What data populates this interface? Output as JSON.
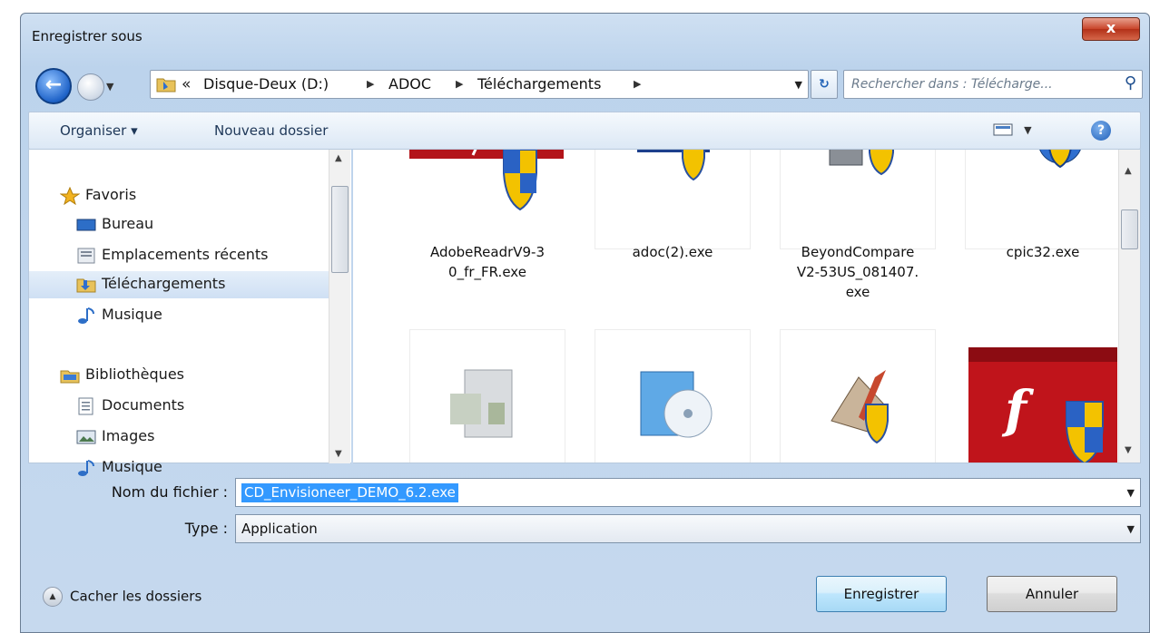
{
  "window": {
    "title": "Enregistrer sous",
    "close_label": "x"
  },
  "address": {
    "crumbs": [
      "Disque-Deux (D:)",
      "ADOC",
      "Téléchargements"
    ],
    "overflow": "«"
  },
  "search": {
    "placeholder": "Rechercher dans : Télécharge..."
  },
  "toolbar": {
    "organise_label": "Organiser ▾",
    "new_folder_label": "Nouveau dossier",
    "help_label": "?"
  },
  "nav": {
    "items": [
      {
        "label": "Favoris",
        "icon": "star-icon",
        "header": true
      },
      {
        "label": "Bureau",
        "icon": "desktop-icon"
      },
      {
        "label": "Emplacements récents",
        "icon": "recent-places-icon"
      },
      {
        "label": "Téléchargements",
        "icon": "downloads-folder-icon",
        "selected": true
      },
      {
        "label": "Musique",
        "icon": "music-icon"
      },
      {
        "label": "Bibliothèques",
        "icon": "libraries-icon",
        "header": true
      },
      {
        "label": "Documents",
        "icon": "documents-icon"
      },
      {
        "label": "Images",
        "icon": "images-icon"
      },
      {
        "label": "Musique",
        "icon": "music-icon"
      }
    ]
  },
  "files": [
    {
      "name": "AdobeReadrV9-3 0_fr_FR.exe",
      "line1": "AdobeReadrV9-3",
      "line2": "0_fr_FR.exe",
      "line3": "",
      "icon": "adobe-installer-icon"
    },
    {
      "name": "adoc(2).exe",
      "line1": "adoc(2).exe",
      "line2": "",
      "line3": "",
      "icon": "adoc-icon"
    },
    {
      "name": "BeyondCompare V2-53US_081407. exe",
      "line1": "BeyondCompare",
      "line2": "V2-53US_081407.",
      "line3": "exe",
      "icon": "installer-icon"
    },
    {
      "name": "cpic32.exe",
      "line1": "cpic32.exe",
      "line2": "",
      "line3": "",
      "icon": "network-setup-icon"
    },
    {
      "name": "",
      "icon": "setup-box-icon"
    },
    {
      "name": "",
      "icon": "software-box-icon"
    },
    {
      "name": "",
      "icon": "sketchup-icon"
    },
    {
      "name": "",
      "icon": "flash-installer-icon"
    }
  ],
  "form": {
    "filename_label": "Nom du fichier :",
    "filename_value": "CD_Envisioneer_DEMO_6.2.exe",
    "type_label": "Type :",
    "type_value": "Application"
  },
  "footer": {
    "hide_folders_label": "Cacher les dossiers",
    "save_label": "Enregistrer",
    "cancel_label": "Annuler"
  },
  "colors": {
    "accent": "#3399ff",
    "close": "#c8442a",
    "frame": "#bcd3ec"
  }
}
